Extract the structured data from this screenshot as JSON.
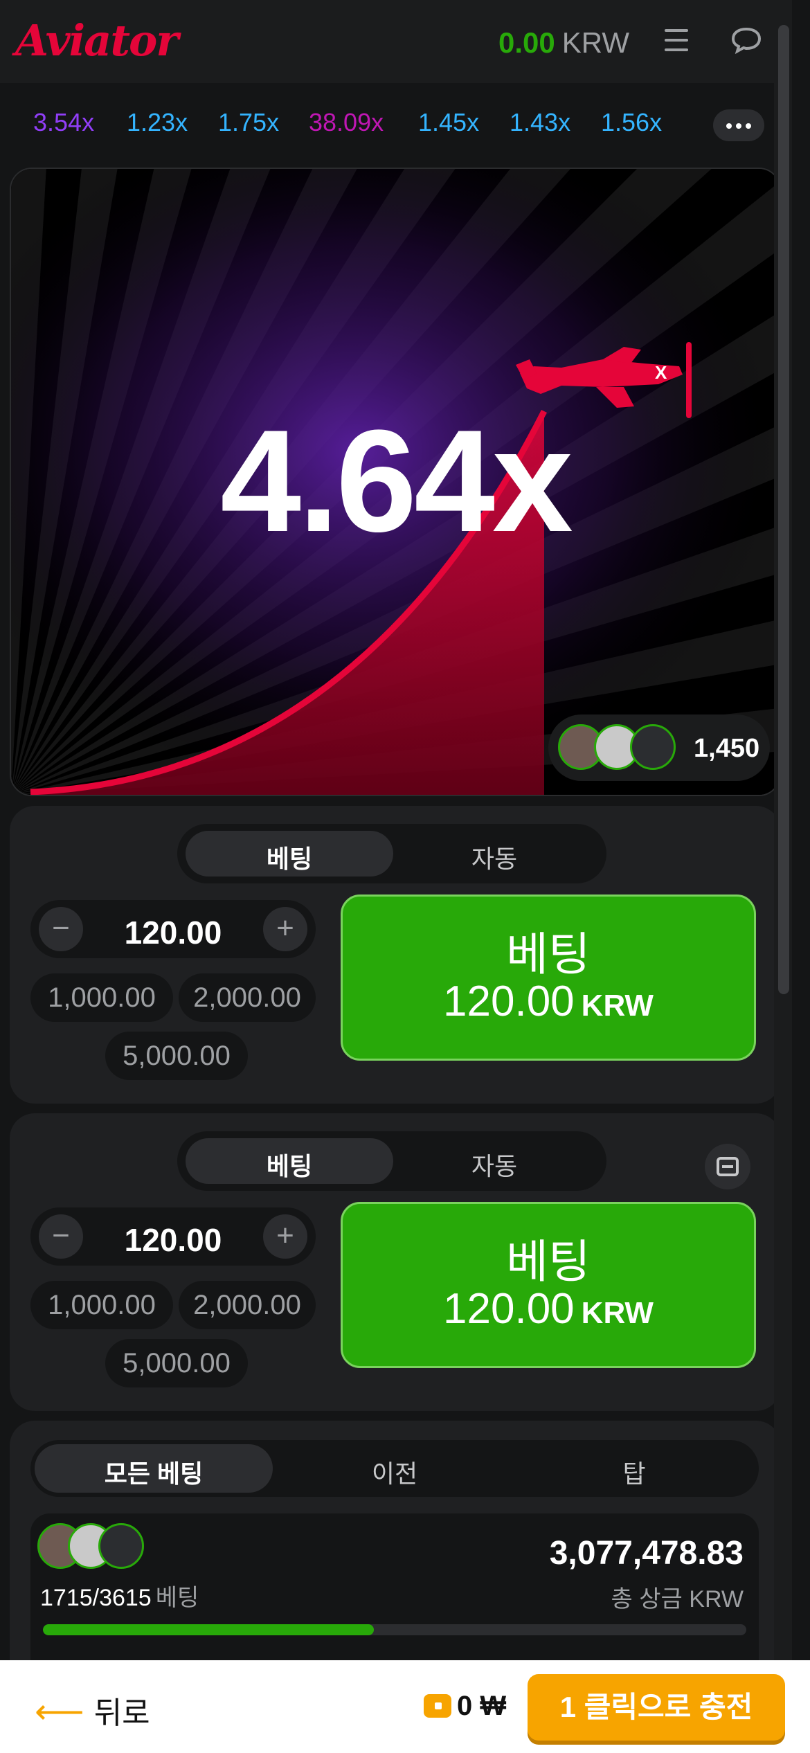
{
  "header": {
    "logo": "Aviator",
    "balance_amount": "0.00",
    "balance_currency": "KRW"
  },
  "history": {
    "items": [
      {
        "value": "3.54x",
        "color": "#913ef8"
      },
      {
        "value": "1.23x",
        "color": "#34b4ff"
      },
      {
        "value": "1.75x",
        "color": "#34b4ff"
      },
      {
        "value": "38.09x",
        "color": "#c017b4"
      },
      {
        "value": "1.45x",
        "color": "#34b4ff"
      },
      {
        "value": "1.43x",
        "color": "#34b4ff"
      },
      {
        "value": "1.56x",
        "color": "#34b4ff"
      }
    ]
  },
  "game": {
    "multiplier": "4.64x",
    "players_count": "1,450"
  },
  "bet_panel_1": {
    "tab_bet": "베팅",
    "tab_auto": "자동",
    "stake": "120.00",
    "minus": "−",
    "plus": "+",
    "chips": [
      "1,000.00",
      "2,000.00",
      "5,000.00"
    ],
    "button_label": "베팅",
    "button_amount": "120.00",
    "button_currency": "KRW"
  },
  "bet_panel_2": {
    "tab_bet": "베팅",
    "tab_auto": "자동",
    "stake": "120.00",
    "minus": "−",
    "plus": "+",
    "chips": [
      "1,000.00",
      "2,000.00",
      "5,000.00"
    ],
    "button_label": "베팅",
    "button_amount": "120.00",
    "button_currency": "KRW"
  },
  "bets_list": {
    "tabs": [
      "모든 베팅",
      "이전",
      "탑"
    ],
    "count": "1715/3615",
    "count_label": "베팅",
    "total": "3,077,478.83",
    "total_label": "총 상금 KRW",
    "progress_fraction": 0.47
  },
  "bottom_bar": {
    "back": "뒤로",
    "wallet_amount": "0",
    "wallet_currency": "₩",
    "topup": "1 클릭으로 충전"
  },
  "colors": {
    "accent_red": "#e50539",
    "green": "#28a909",
    "orange": "#f7a400"
  }
}
